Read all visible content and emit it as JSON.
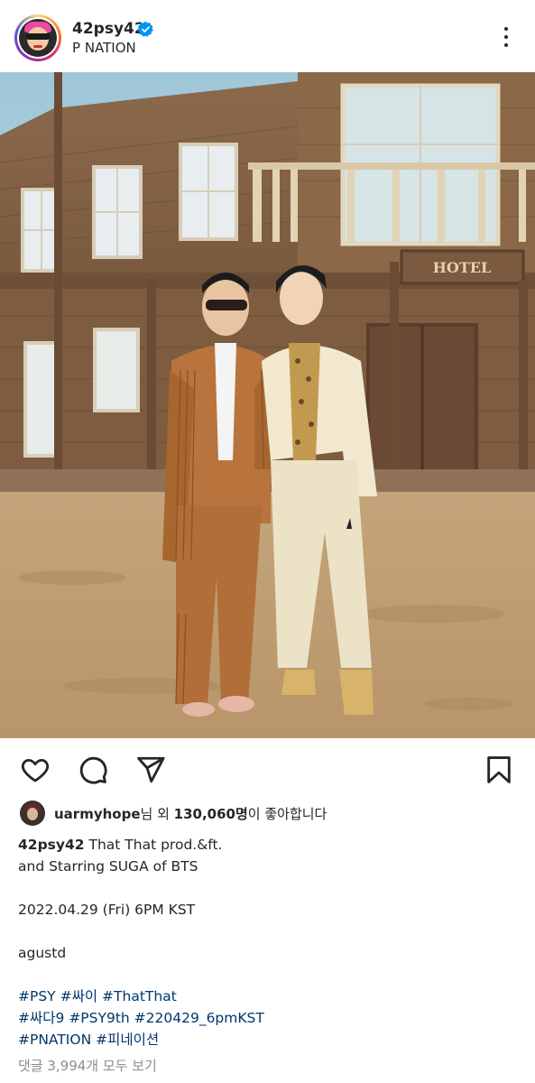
{
  "header": {
    "username": "42psy42",
    "verified": true,
    "subtitle": "P NATION"
  },
  "post": {
    "image_description_icon": "photo"
  },
  "actions": {
    "like_icon": "heart-icon",
    "comment_icon": "comment-icon",
    "share_icon": "send-icon",
    "save_icon": "bookmark-icon"
  },
  "likes": {
    "liker": "uarmyhope",
    "suffix1": "님 외 ",
    "count": "130,060명",
    "suffix2": "이 좋아합니다"
  },
  "caption": {
    "username": "42psy42",
    "line1_text": " That That prod.&ft.",
    "line2": "and Starring SUGA of BTS",
    "line3": "2022.04.29 (Fri) 6PM KST",
    "line4": "agustd",
    "hashtags_row1": [
      "#PSY",
      "#싸이",
      "#ThatThat"
    ],
    "hashtags_row2": [
      "#싸다9",
      "#PSY9th",
      "#220429_6pmKST"
    ],
    "hashtags_row3": [
      "#PNATION",
      "#피네이션"
    ]
  },
  "comments_link": "댓글 3,994개 모두 보기",
  "colors": {
    "text": "#262626",
    "hashtag": "#00376b",
    "muted": "#8e8e8e",
    "verified": "#0095f6"
  }
}
